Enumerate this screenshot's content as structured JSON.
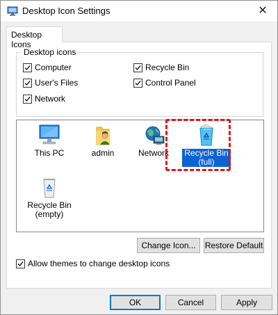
{
  "window": {
    "title": "Desktop Icon Settings",
    "close_glyph": "✕"
  },
  "tab": {
    "label": "Desktop Icons"
  },
  "desktop_icons_group": {
    "legend": "Desktop icons",
    "checkboxes": [
      {
        "label": "Computer",
        "checked": true
      },
      {
        "label": "Recycle Bin",
        "checked": true
      },
      {
        "label": "User's Files",
        "checked": true
      },
      {
        "label": "Control Panel",
        "checked": true
      },
      {
        "label": "Network",
        "checked": true
      }
    ]
  },
  "icon_list": [
    {
      "label": "This PC",
      "icon": "computer-icon",
      "selected": false
    },
    {
      "label": "admin",
      "icon": "user-folder-icon",
      "selected": false
    },
    {
      "label": "Network",
      "icon": "network-icon",
      "selected": false
    },
    {
      "label_line1": "Recycle Bin",
      "label_line2": "(full)",
      "icon": "recycle-bin-full-icon",
      "selected": true
    },
    {
      "label_line1": "Recycle Bin",
      "label_line2": "(empty)",
      "icon": "recycle-bin-empty-icon",
      "selected": false
    }
  ],
  "buttons": {
    "change_icon": "Change Icon...",
    "restore_default": "Restore Default",
    "ok": "OK",
    "cancel": "Cancel",
    "apply": "Apply"
  },
  "allow_themes": {
    "label": "Allow themes to change desktop icons",
    "checked": true
  },
  "colors": {
    "selection": "#0a64d4",
    "highlight_border": "#e3121b",
    "default_button_border": "#0078d7"
  }
}
